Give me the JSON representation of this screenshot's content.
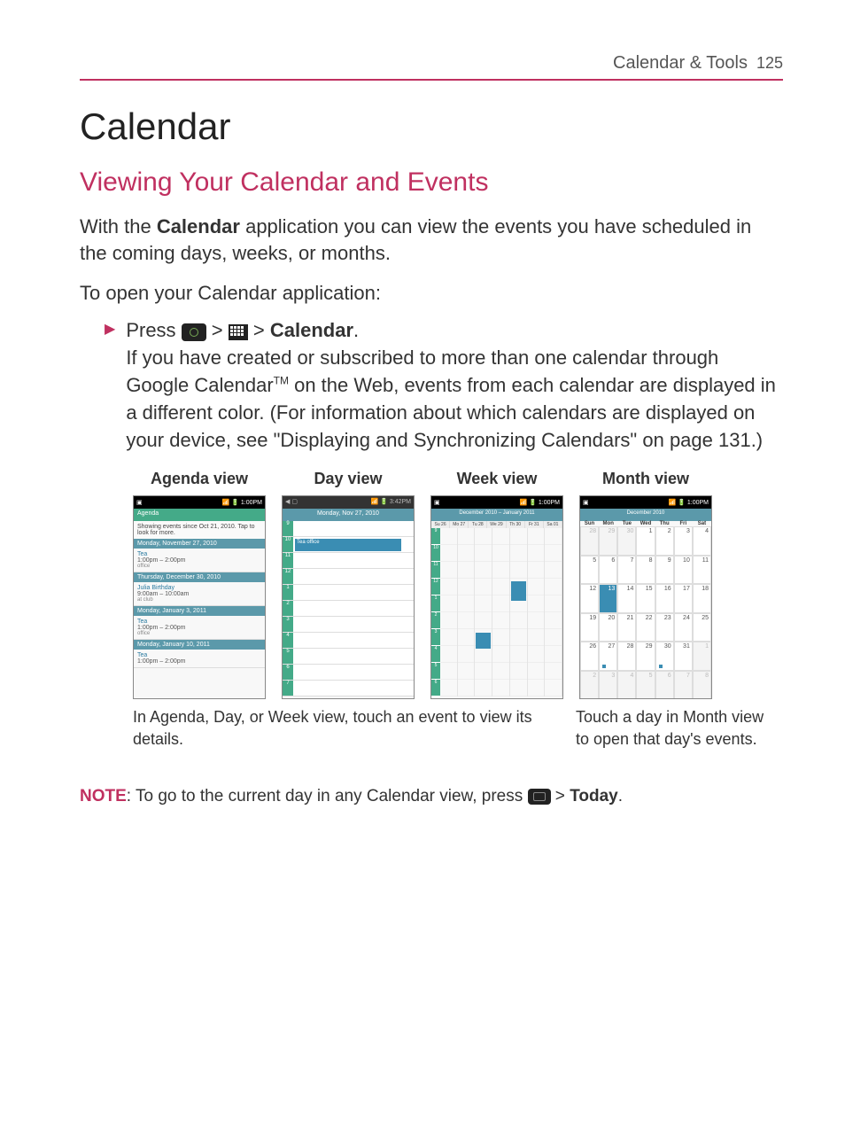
{
  "header": {
    "section": "Calendar & Tools",
    "page": "125"
  },
  "title": "Calendar",
  "subtitle": "Viewing Your Calendar and Events",
  "intro_pre": "With the ",
  "intro_app": "Calendar",
  "intro_post": " application you can view the events you have scheduled in the coming days, weeks, or months.",
  "open_heading": "To open your Calendar application:",
  "step": {
    "press": "Press ",
    "gt": " > ",
    "app": "Calendar",
    "dot": ".",
    "line2_a": "If you have created or subscribed to more than one calendar through Google Calendar",
    "tm": "TM",
    "line2_b": " on the Web, events from each calendar are displayed in a different color. (For information about which calendars are displayed on your device, see \"Displaying and Synchronizing Calendars\" on page 131.)"
  },
  "views": {
    "agenda": {
      "label": "Agenda view",
      "status_time": "1:00PM",
      "tab": "Agenda",
      "info": "Showing events since Oct 21, 2010. Tap to look for more.",
      "groups": [
        {
          "date": "Monday, November 27, 2010",
          "events": [
            {
              "title": "Tea",
              "time": "1:00pm – 2:00pm",
              "loc": "office"
            }
          ]
        },
        {
          "date": "Thursday, December 30, 2010",
          "events": [
            {
              "title": "Julia Birthday",
              "time": "9:00am – 10:00am",
              "loc": "at club"
            }
          ]
        },
        {
          "date": "Monday, January 3, 2011",
          "events": [
            {
              "title": "Tea",
              "time": "1:00pm – 2:00pm",
              "loc": "office"
            }
          ]
        },
        {
          "date": "Monday, January 10, 2011",
          "events": [
            {
              "title": "Tea",
              "time": "1:00pm – 2:00pm",
              "loc": ""
            }
          ]
        }
      ]
    },
    "day": {
      "label": "Day view",
      "status_time": "3:42PM",
      "subhead": "Monday, Nov 27, 2010",
      "event": "Tea  office"
    },
    "week": {
      "label": "Week view",
      "status_time": "1:00PM",
      "subhead": "December 2010 – January 2011",
      "day_cols": [
        "Su 26",
        "Mo 27",
        "Tu 28",
        "We 29",
        "Th 30",
        "Fr 31",
        "Sa 01"
      ]
    },
    "month": {
      "label": "Month view",
      "status_time": "1:00PM",
      "subhead": "December 2010",
      "dow": [
        "Sun",
        "Mon",
        "Tue",
        "Wed",
        "Thu",
        "Fri",
        "Sat"
      ],
      "grid": [
        [
          "28",
          "29",
          "30",
          "1",
          "2",
          "3",
          "4"
        ],
        [
          "5",
          "6",
          "7",
          "8",
          "9",
          "10",
          "11"
        ],
        [
          "12",
          "13",
          "14",
          "15",
          "16",
          "17",
          "18"
        ],
        [
          "19",
          "20",
          "21",
          "22",
          "23",
          "24",
          "25"
        ],
        [
          "26",
          "27",
          "28",
          "29",
          "30",
          "31",
          "1"
        ],
        [
          "2",
          "3",
          "4",
          "5",
          "6",
          "7",
          "8"
        ]
      ]
    }
  },
  "captions": {
    "left": "In Agenda, Day, or Week view, touch an event to view its details.",
    "right": "Touch a day in Month view to open that day's events."
  },
  "note": {
    "label": "NOTE",
    "sep": ": ",
    "text_a": "To go to the current day in any Calendar view, press ",
    "gt": " > ",
    "today": "Today",
    "dot": "."
  }
}
